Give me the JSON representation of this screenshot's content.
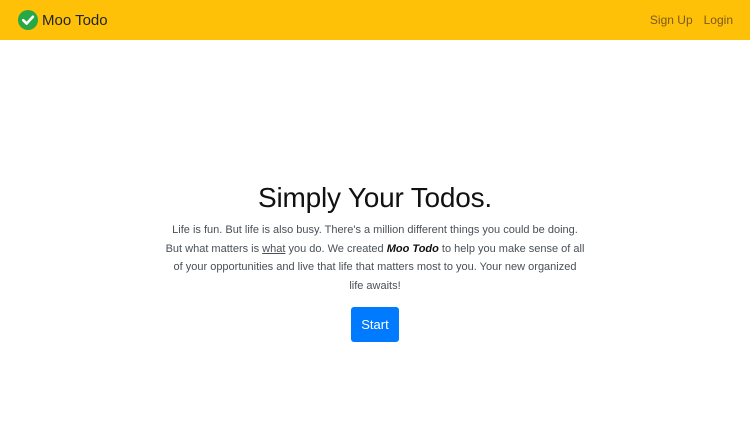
{
  "navbar": {
    "brand_icon": "check-circle-icon",
    "brand_name": "Moo Todo",
    "links": [
      "Sign Up",
      "Login"
    ],
    "background": "#ffc107"
  },
  "hero": {
    "title": "Simply Your Todos.",
    "text_1": "Life is fun. But life is also busy. There's a million different things you could be doing. But what matters is ",
    "text_what": "what",
    "text_2": " you do. We created ",
    "text_brand": "Moo Todo",
    "text_3": " to help you make sense of all of your opportunities and live that life that matters most to you. Your new organized life awaits!",
    "start_label": "Start",
    "start_color": "#007bff"
  }
}
